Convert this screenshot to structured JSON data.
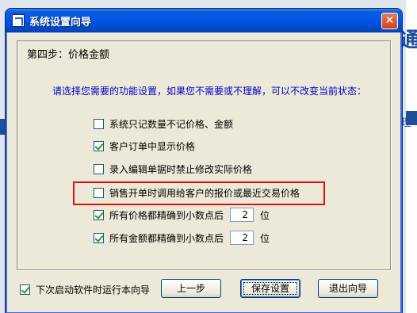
{
  "background": {
    "glyph_top_right": "通",
    "glyph_mid_right": "理"
  },
  "window": {
    "title": "系统设置向导",
    "close_glyph": "✕"
  },
  "panel": {
    "step_title": "第四步：价格金额",
    "instruction": "请选择您需要的功能设置，如果您不需要或不理解，可以不改变当前状态：",
    "options": [
      {
        "label": "系统只记数量不记价格、金额",
        "checked": false
      },
      {
        "label": "客户订单中显示价格",
        "checked": true
      },
      {
        "label": "录入编辑单据时禁止修改实际价格",
        "checked": false
      },
      {
        "label": "销售开单时调用给客户的报价或最近交易价格",
        "checked": false
      }
    ],
    "price_decimals": {
      "label": "所有价格都精确到小数点后",
      "value": "2",
      "suffix": "位",
      "checked": true
    },
    "amount_decimals": {
      "label": "所有金额都精确到小数点后",
      "value": "2",
      "suffix": "位",
      "checked": true
    },
    "highlight_color": "#e01010"
  },
  "footer": {
    "startup_label": "下次启动软件时运行本向导",
    "startup_checked": true,
    "prev_label": "上一步",
    "save_label": "保存设置",
    "exit_label": "退出向导"
  }
}
